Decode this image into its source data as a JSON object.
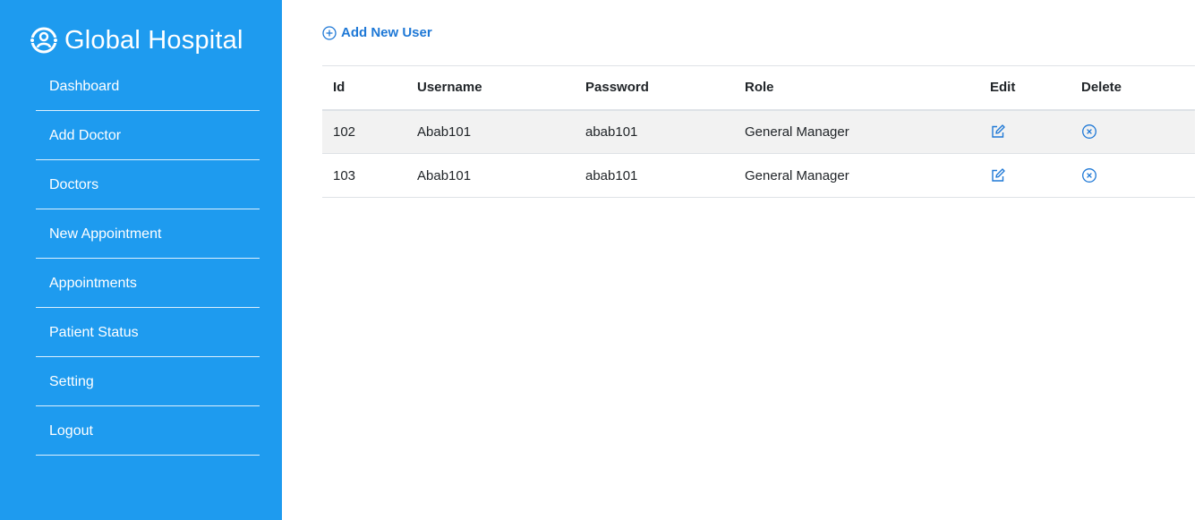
{
  "brand": {
    "title": "Global Hospital",
    "icon": "hospital-user-icon",
    "color": "#1e9bef"
  },
  "sidebar": {
    "items": [
      {
        "label": "Dashboard"
      },
      {
        "label": "Add Doctor"
      },
      {
        "label": "Doctors"
      },
      {
        "label": "New Appointment"
      },
      {
        "label": "Appointments"
      },
      {
        "label": "Patient Status"
      },
      {
        "label": "Setting"
      },
      {
        "label": "Logout"
      }
    ]
  },
  "main": {
    "add_user_label": "Add New User",
    "add_user_icon": "plus-circle-icon",
    "accent_color": "#1e78d6",
    "table": {
      "headers": {
        "id": "Id",
        "username": "Username",
        "password": "Password",
        "role": "Role",
        "edit": "Edit",
        "delete": "Delete"
      },
      "rows": [
        {
          "id": "102",
          "username": "Abab101",
          "password": "abab101",
          "role": "General Manager",
          "edit_icon": "edit-icon",
          "delete_icon": "x-circle-icon"
        },
        {
          "id": "103",
          "username": "Abab101",
          "password": "abab101",
          "role": "General Manager",
          "edit_icon": "edit-icon",
          "delete_icon": "x-circle-icon"
        }
      ]
    }
  }
}
